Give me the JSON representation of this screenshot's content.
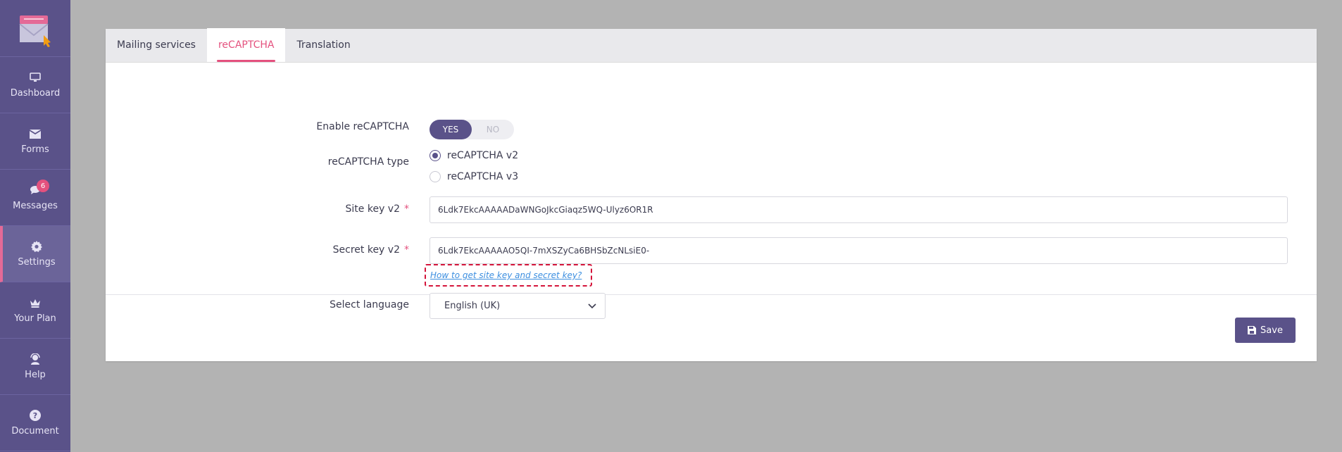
{
  "sidebar": {
    "items": [
      {
        "label": "Dashboard",
        "icon": "monitor-icon"
      },
      {
        "label": "Forms",
        "icon": "envelope-icon"
      },
      {
        "label": "Messages",
        "icon": "chat-icon",
        "badge": "6"
      },
      {
        "label": "Settings",
        "icon": "gear-icon",
        "active": true
      },
      {
        "label": "Your Plan",
        "icon": "crown-icon"
      },
      {
        "label": "Help",
        "icon": "support-icon"
      },
      {
        "label": "Document",
        "icon": "question-icon"
      }
    ]
  },
  "tabs": [
    {
      "label": "Mailing services"
    },
    {
      "label": "reCAPTCHA",
      "active": true
    },
    {
      "label": "Translation"
    }
  ],
  "form": {
    "enable_label": "Enable reCAPTCHA",
    "toggle_yes": "YES",
    "toggle_no": "NO",
    "type_label": "reCAPTCHA type",
    "type_v2": "reCAPTCHA v2",
    "type_v3": "reCAPTCHA v3",
    "site_key_label": "Site key v2",
    "site_key_value": "6Ldk7EkcAAAAADaWNGoJkcGiaqz5WQ-Ulyz6OR1R",
    "secret_key_label": "Secret key v2",
    "secret_key_value": "6Ldk7EkcAAAAAO5QI-7mXSZyCa6BHSbZcNLsiE0-",
    "required_mark": "*",
    "help_link": "How to get site key and secret key?",
    "language_label": "Select language",
    "language_value": "English (UK)"
  },
  "actions": {
    "save_label": "Save"
  },
  "colors": {
    "accent": "#5a5289",
    "pink": "#e4517e",
    "link": "#3d8fe0",
    "highlight": "#d4143a"
  }
}
